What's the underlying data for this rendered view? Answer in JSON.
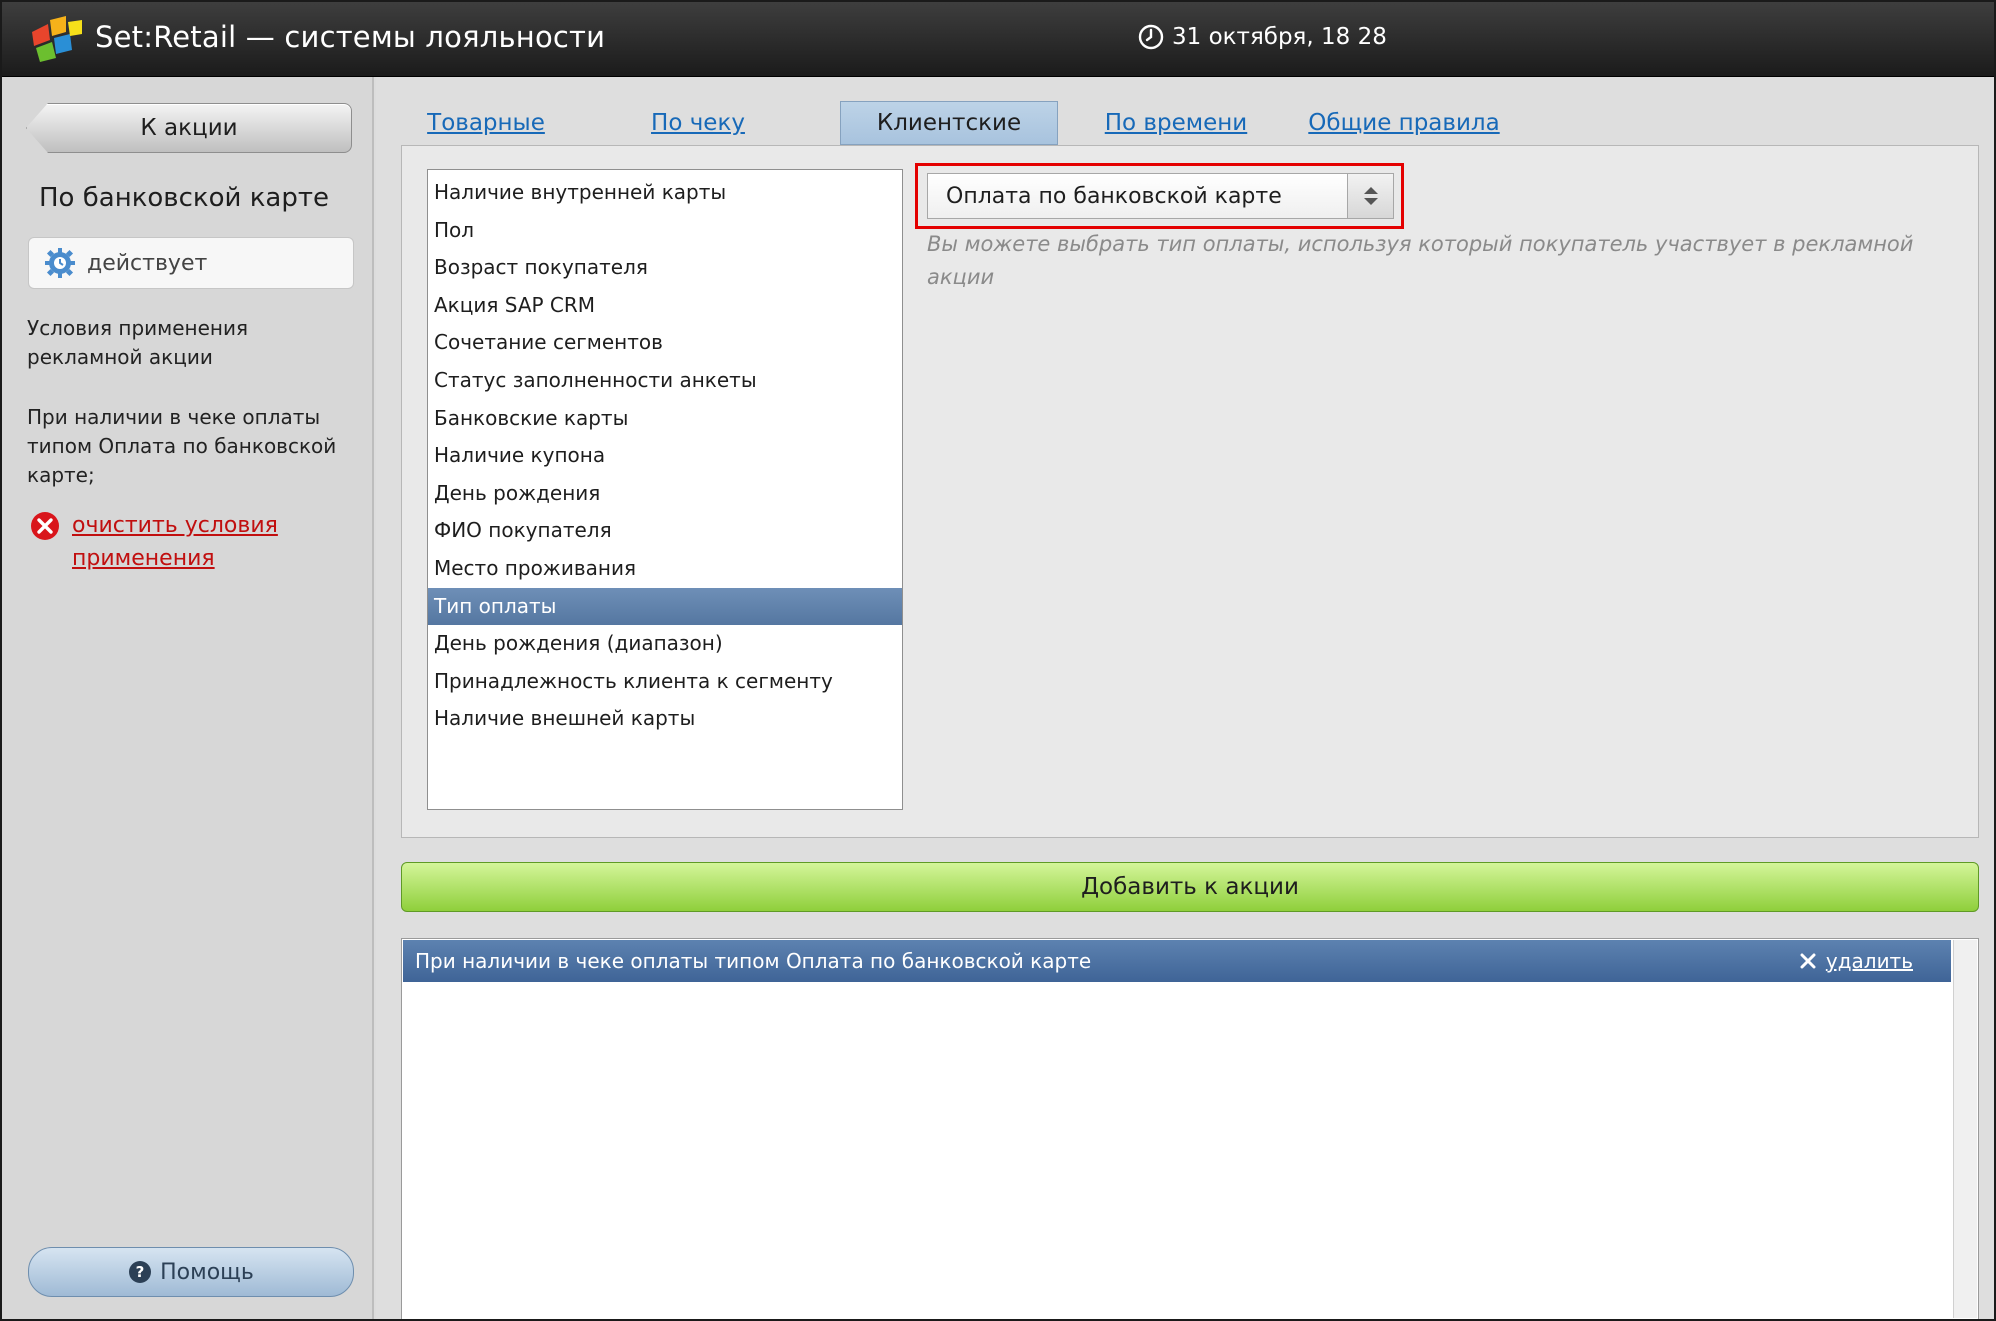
{
  "header": {
    "title": "Set:Retail — системы лояльности",
    "datetime": "31 октября, 18 28",
    "logo_icon": "set-retail-logo-icon",
    "clock_icon": "clock-icon"
  },
  "sidebar": {
    "back_button": "К акции",
    "promo_name": "По банковской карте",
    "status": "действует",
    "conditions_heading": "Условия применения рекламной акции",
    "conditions_summary": "При наличии в чеке оплаты типом Оплата по банковской карте;",
    "clear_link": "очистить условия применения",
    "help_button": "Помощь"
  },
  "tabs": [
    {
      "label": "Товарные",
      "active": false
    },
    {
      "label": "По чеку",
      "active": false
    },
    {
      "label": "Клиентские",
      "active": true
    },
    {
      "label": "По времени",
      "active": false
    },
    {
      "label": "Общие правила",
      "active": false
    }
  ],
  "criteria_list": {
    "items": [
      "Наличие внутренней карты",
      "Пол",
      "Возраст покупателя",
      "Акция SAP CRM",
      "Сочетание сегментов",
      "Статус заполненности анкеты",
      "Банковские карты",
      "Наличие купона",
      "День рождения",
      "ФИО покупателя",
      "Место проживания",
      "Тип оплаты",
      "День рождения (диапазон)",
      "Принадлежность клиента к сегменту",
      "Наличие внешней карты"
    ],
    "selected": "Тип оплаты"
  },
  "payment_select": {
    "value": "Оплата по банковской карте",
    "hint": "Вы можете выбрать тип оплаты, используя который покупатель участвует в рекламной акции"
  },
  "add_button": "Добавить к акции",
  "conditions": {
    "row_text": "При наличии в чеке оплаты типом Оплата по банковской карте",
    "delete_label": "удалить"
  },
  "colors": {
    "accent_blue": "#1769b8",
    "selected_row": "#5577a1",
    "add_green": "#8fcf3b",
    "highlight_red": "#e40000",
    "link_red": "#c10f0f"
  }
}
